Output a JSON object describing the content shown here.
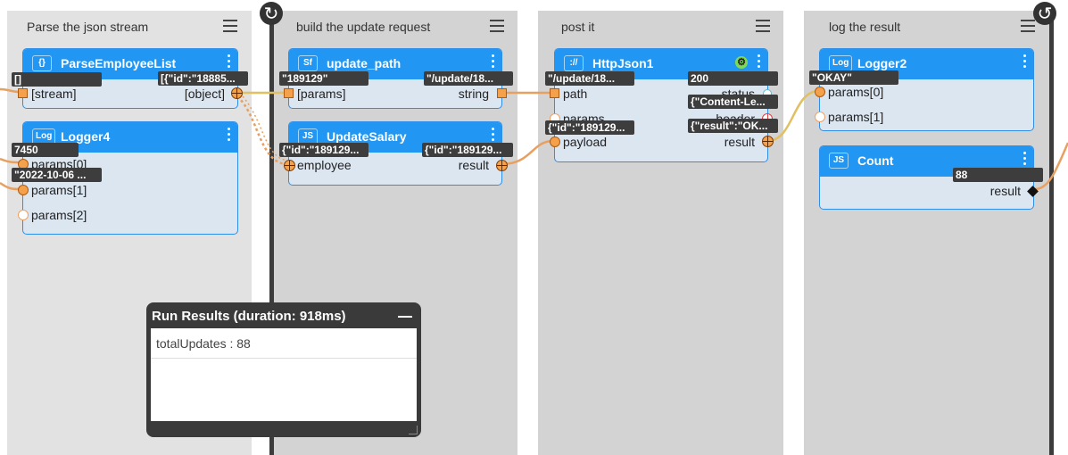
{
  "panels": [
    {
      "title": "Parse the json stream"
    },
    {
      "title": "build the update request"
    },
    {
      "title": "post it"
    },
    {
      "title": "log the result"
    }
  ],
  "nodes": {
    "parse": {
      "icon": "{}",
      "title": "ParseEmployeeList",
      "inputs": [
        "[stream]"
      ],
      "outputs": [
        "[object]"
      ],
      "values": {
        "stream": "[]",
        "object": "[{\"id\":\"18885..."
      }
    },
    "logger4": {
      "icon": "Log",
      "title": "Logger4",
      "inputs": [
        "params[0]",
        "params[1]",
        "params[2]"
      ],
      "values": {
        "p0": "7450",
        "p1": "\"2022-10-06 ..."
      }
    },
    "update_path": {
      "icon": "Sf",
      "title": "update_path",
      "inputs": [
        "[params]"
      ],
      "outputs": [
        "string"
      ],
      "values": {
        "params": "\"189129\"",
        "string": "\"/update/18..."
      }
    },
    "update_salary": {
      "icon": "JS",
      "title": "UpdateSalary",
      "inputs": [
        "employee"
      ],
      "outputs": [
        "result"
      ],
      "values": {
        "employee": "{\"id\":\"189129...",
        "result": "{\"id\":\"189129..."
      }
    },
    "http": {
      "icon": "://",
      "title": "HttpJson1",
      "inputs": [
        "path",
        "params",
        "payload"
      ],
      "outputs": [
        "status",
        "header",
        "result"
      ],
      "values": {
        "path": "\"/update/18...",
        "payload": "{\"id\":\"189129...",
        "status": "200",
        "header": "{\"Content-Le...",
        "result": "{\"result\":\"OK..."
      }
    },
    "logger2": {
      "icon": "Log",
      "title": "Logger2",
      "inputs": [
        "params[0]",
        "params[1]"
      ],
      "values": {
        "p0": "\"OKAY\""
      }
    },
    "count": {
      "icon": "JS",
      "title": "Count",
      "outputs": [
        "result"
      ],
      "values": {
        "result": "88"
      }
    }
  },
  "results": {
    "title": "Run Results (duration: 918ms)",
    "rows": [
      "totalUpdates : 88"
    ]
  },
  "colors": {
    "node_header": "#2196f3",
    "node_body": "#dce6f1",
    "panel_bg": "#d6d6d6",
    "wire": "#e8a060",
    "wire_yellow": "#e0c060"
  }
}
